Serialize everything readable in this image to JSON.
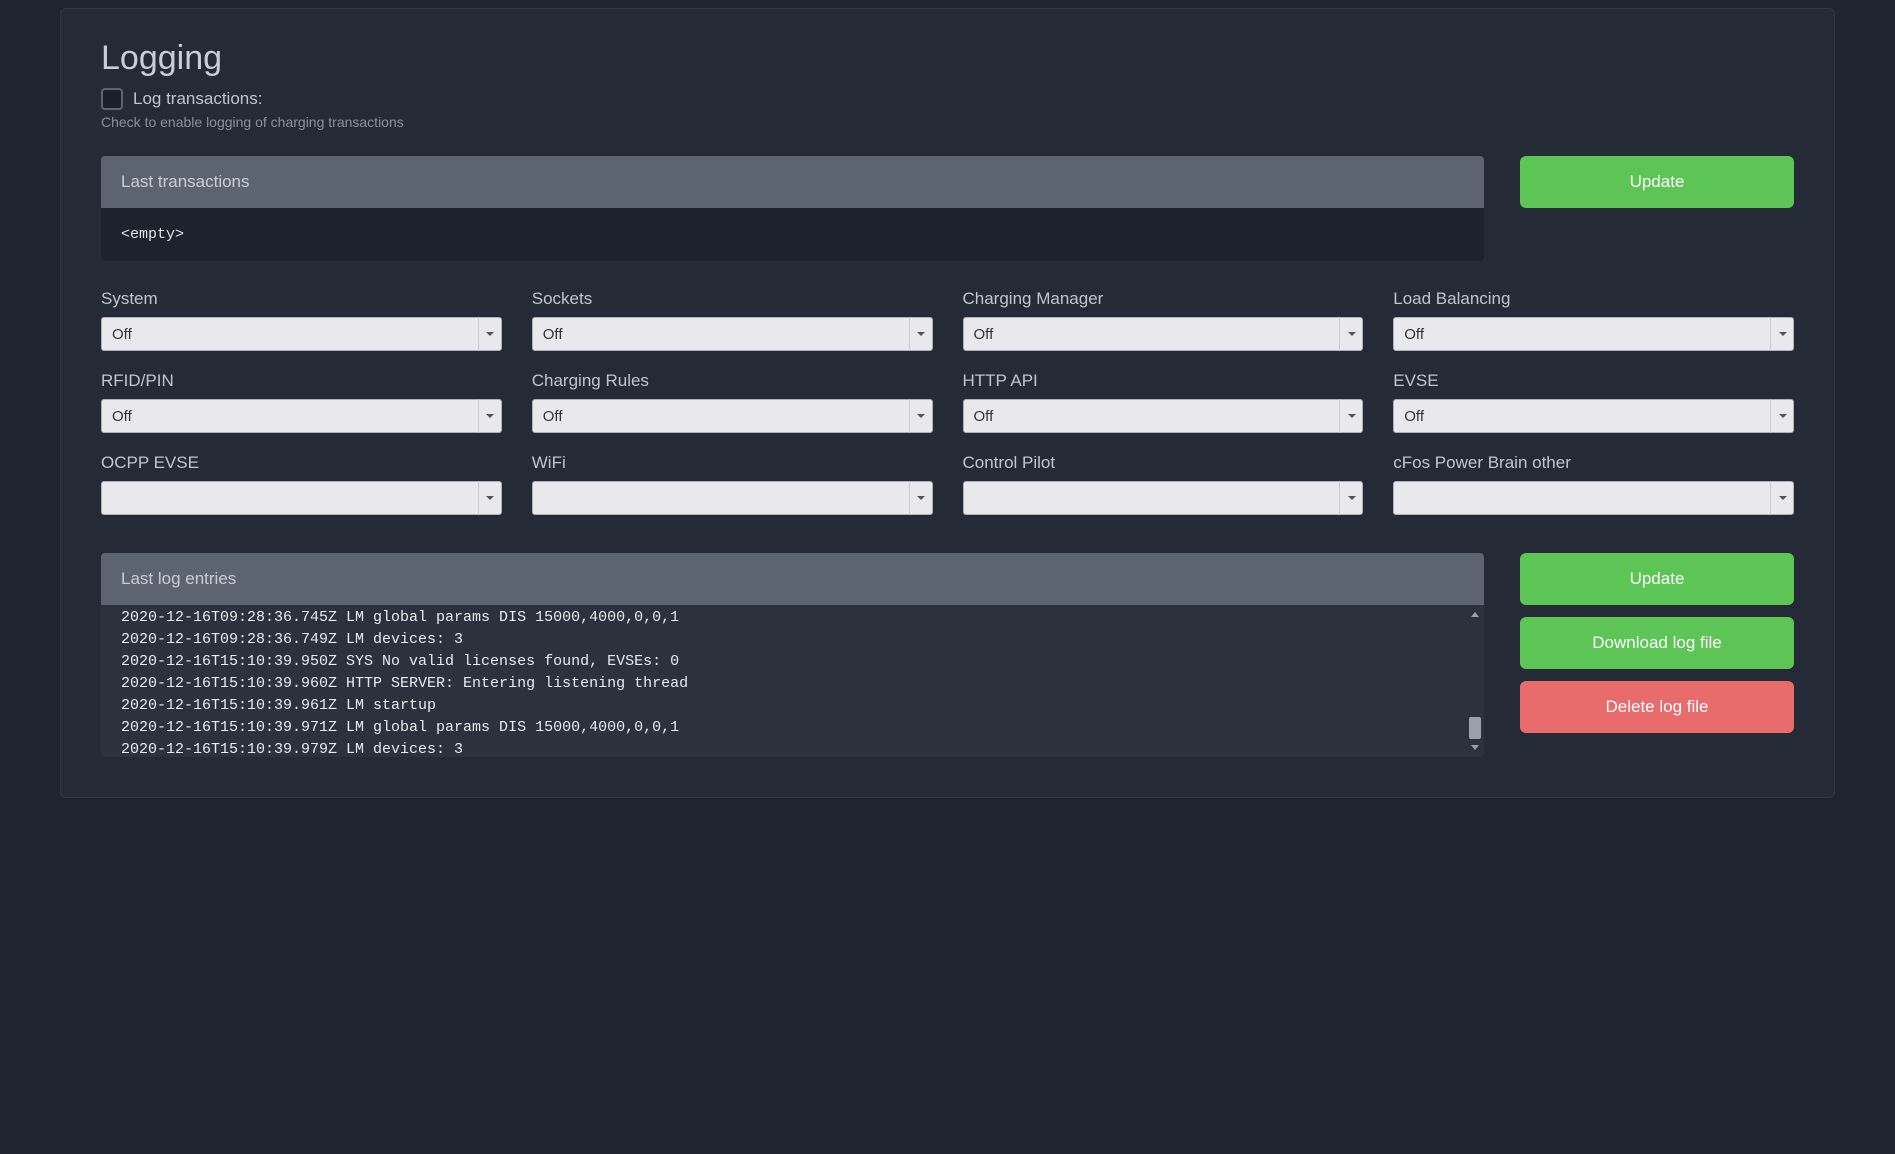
{
  "title": "Logging",
  "log_transactions": {
    "label": "Log transactions:",
    "help": "Check to enable logging of charging transactions"
  },
  "transactions_panel": {
    "header": "Last transactions",
    "body": "<empty>"
  },
  "update_btn": "Update",
  "selects": [
    {
      "label": "System",
      "value": "Off"
    },
    {
      "label": "Sockets",
      "value": "Off"
    },
    {
      "label": "Charging Manager",
      "value": "Off"
    },
    {
      "label": "Load Balancing",
      "value": "Off"
    },
    {
      "label": "RFID/PIN",
      "value": "Off"
    },
    {
      "label": "Charging Rules",
      "value": "Off"
    },
    {
      "label": "HTTP API",
      "value": "Off"
    },
    {
      "label": "EVSE",
      "value": "Off"
    },
    {
      "label": "OCPP EVSE",
      "value": ""
    },
    {
      "label": "WiFi",
      "value": ""
    },
    {
      "label": "Control Pilot",
      "value": ""
    },
    {
      "label": "cFos Power Brain other",
      "value": ""
    }
  ],
  "log_entries": {
    "header": "Last log entries",
    "lines": [
      "2020-12-16T09:28:36.745Z LM global params DIS 15000,4000,0,0,1",
      "2020-12-16T09:28:36.749Z LM devices: 3",
      "2020-12-16T15:10:39.950Z SYS No valid licenses found, EVSEs: 0",
      "2020-12-16T15:10:39.960Z HTTP SERVER: Entering listening thread",
      "2020-12-16T15:10:39.961Z LM startup",
      "2020-12-16T15:10:39.971Z LM global params DIS 15000,4000,0,0,1",
      "2020-12-16T15:10:39.979Z LM devices: 3"
    ]
  },
  "log_buttons": {
    "update": "Update",
    "download": "Download log file",
    "delete": "Delete log file"
  }
}
